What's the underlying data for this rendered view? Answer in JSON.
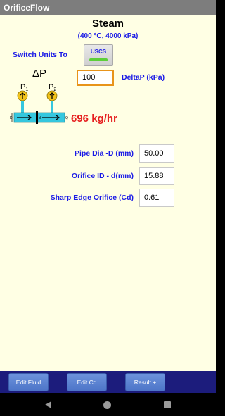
{
  "app": {
    "title": "OrificeFlow"
  },
  "fluid": {
    "name": "Steam",
    "conditions": "(400 °C, 4000 kPa)"
  },
  "units": {
    "switch_label": "Switch Units To",
    "button_label": "USCS"
  },
  "delta_p": {
    "symbol": "ΔP",
    "value": "100",
    "label": "DeltaP (kPa)"
  },
  "diagram": {
    "p1": "P",
    "p1_sub": "1",
    "p2": "P",
    "p2_sub": "2",
    "dim_D": "D",
    "dim_d": "d",
    "dim_Q": "Q"
  },
  "result": {
    "flow": "696 kg/hr"
  },
  "inputs": [
    {
      "label": "Pipe Dia -D (mm)",
      "value": "50.00"
    },
    {
      "label": "Orifice ID - d(mm)",
      "value": "15.88"
    },
    {
      "label": "Sharp Edge Orifice (Cd)",
      "value": "0.61"
    }
  ],
  "bottom_bar": {
    "edit_fluid": "Edit Fluid",
    "edit_cd": "Edit Cd",
    "result": "Result +"
  },
  "colors": {
    "accent_text": "#1a1ae6",
    "result": "#e62020",
    "background": "#ffffe4",
    "bottom_bar": "#1c1c7c"
  }
}
